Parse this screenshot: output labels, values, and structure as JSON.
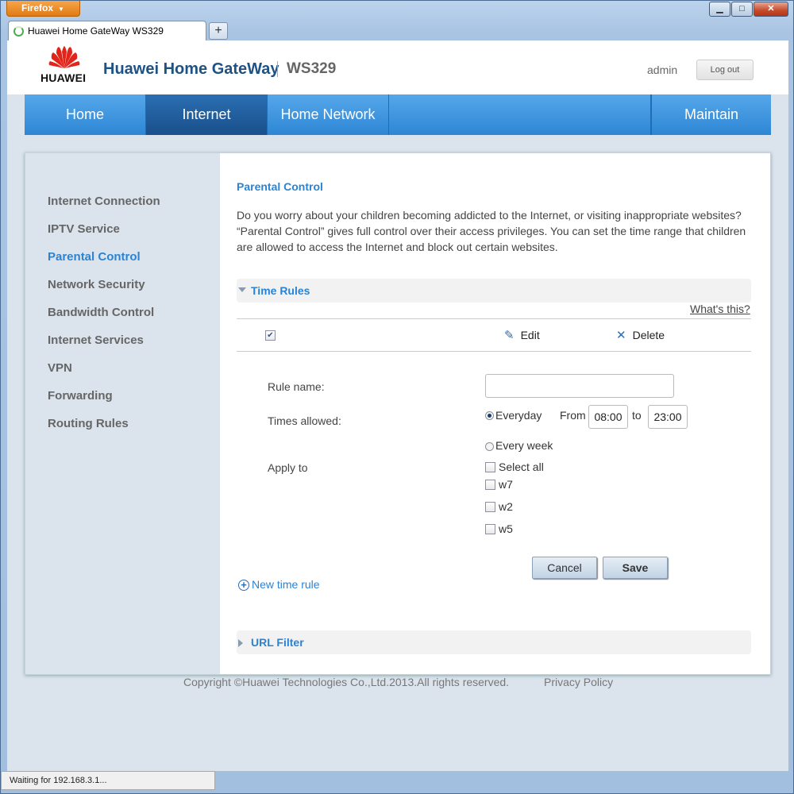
{
  "browser": {
    "menu_button": "Firefox",
    "tab_title": "Huawei Home GateWay WS329",
    "new_tab": "+",
    "controls": {
      "minimize": "▁",
      "maximize": "□",
      "close": "✕"
    },
    "status_text": "Waiting for 192.168.3.1..."
  },
  "header": {
    "logo_text": "HUAWEI",
    "product_name": "Huawei Home GateWay",
    "model": "WS329",
    "user": "admin",
    "logout_label": "Log out"
  },
  "nav": {
    "items": [
      {
        "label": "Home",
        "active": false
      },
      {
        "label": "Internet",
        "active": true
      },
      {
        "label": "Home Network",
        "active": false
      },
      {
        "label": "Maintain",
        "active": false
      }
    ]
  },
  "sidebar": {
    "items": [
      {
        "label": "Internet Connection",
        "active": false
      },
      {
        "label": "IPTV Service",
        "active": false
      },
      {
        "label": "Parental Control",
        "active": true
      },
      {
        "label": "Network Security",
        "active": false
      },
      {
        "label": "Bandwidth Control",
        "active": false
      },
      {
        "label": "Internet Services",
        "active": false
      },
      {
        "label": "VPN",
        "active": false
      },
      {
        "label": "Forwarding",
        "active": false
      },
      {
        "label": "Routing Rules",
        "active": false
      }
    ]
  },
  "content": {
    "title": "Parental Control",
    "description": "Do you worry about your children becoming addicted to the Internet, or visiting inappropriate websites? “Parental Control” gives full control over their access privileges. You can set the time range that children are allowed to access the Internet and block out certain websites.",
    "time_rules": {
      "section_label": "Time Rules",
      "whats_this": "What's this?",
      "toolbar": {
        "select_all_checked": true,
        "edit_label": "Edit",
        "delete_label": "Delete"
      },
      "form": {
        "rule_name_label": "Rule name:",
        "rule_name_value": "",
        "times_allowed_label": "Times allowed:",
        "everyday_label": "Everyday",
        "from_label": "From",
        "from_value": "08:00",
        "to_label": "to",
        "to_value": "23:00",
        "every_week_label": "Every week",
        "apply_to_label": "Apply to",
        "select_all_label": "Select all",
        "devices": [
          "w7",
          "w2",
          "w5"
        ],
        "cancel_label": "Cancel",
        "save_label": "Save"
      },
      "new_rule_label": "New time rule"
    },
    "url_filter": {
      "section_label": "URL Filter"
    }
  },
  "footer": {
    "copyright": "Copyright ©Huawei Technologies Co.,Ltd.2013.All rights reserved.",
    "privacy": "Privacy Policy"
  },
  "colors": {
    "accent": "#2a83d3",
    "nav_active": "#1a4f8c",
    "brand_red": "#e1251b"
  }
}
